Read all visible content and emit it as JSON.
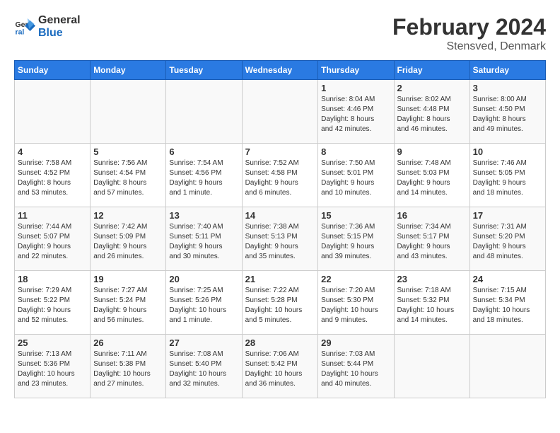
{
  "header": {
    "logo_line1": "General",
    "logo_line2": "Blue",
    "month_year": "February 2024",
    "location": "Stensved, Denmark"
  },
  "days_of_week": [
    "Sunday",
    "Monday",
    "Tuesday",
    "Wednesday",
    "Thursday",
    "Friday",
    "Saturday"
  ],
  "weeks": [
    [
      {
        "day": "",
        "info": ""
      },
      {
        "day": "",
        "info": ""
      },
      {
        "day": "",
        "info": ""
      },
      {
        "day": "",
        "info": ""
      },
      {
        "day": "1",
        "info": "Sunrise: 8:04 AM\nSunset: 4:46 PM\nDaylight: 8 hours\nand 42 minutes."
      },
      {
        "day": "2",
        "info": "Sunrise: 8:02 AM\nSunset: 4:48 PM\nDaylight: 8 hours\nand 46 minutes."
      },
      {
        "day": "3",
        "info": "Sunrise: 8:00 AM\nSunset: 4:50 PM\nDaylight: 8 hours\nand 49 minutes."
      }
    ],
    [
      {
        "day": "4",
        "info": "Sunrise: 7:58 AM\nSunset: 4:52 PM\nDaylight: 8 hours\nand 53 minutes."
      },
      {
        "day": "5",
        "info": "Sunrise: 7:56 AM\nSunset: 4:54 PM\nDaylight: 8 hours\nand 57 minutes."
      },
      {
        "day": "6",
        "info": "Sunrise: 7:54 AM\nSunset: 4:56 PM\nDaylight: 9 hours\nand 1 minute."
      },
      {
        "day": "7",
        "info": "Sunrise: 7:52 AM\nSunset: 4:58 PM\nDaylight: 9 hours\nand 6 minutes."
      },
      {
        "day": "8",
        "info": "Sunrise: 7:50 AM\nSunset: 5:01 PM\nDaylight: 9 hours\nand 10 minutes."
      },
      {
        "day": "9",
        "info": "Sunrise: 7:48 AM\nSunset: 5:03 PM\nDaylight: 9 hours\nand 14 minutes."
      },
      {
        "day": "10",
        "info": "Sunrise: 7:46 AM\nSunset: 5:05 PM\nDaylight: 9 hours\nand 18 minutes."
      }
    ],
    [
      {
        "day": "11",
        "info": "Sunrise: 7:44 AM\nSunset: 5:07 PM\nDaylight: 9 hours\nand 22 minutes."
      },
      {
        "day": "12",
        "info": "Sunrise: 7:42 AM\nSunset: 5:09 PM\nDaylight: 9 hours\nand 26 minutes."
      },
      {
        "day": "13",
        "info": "Sunrise: 7:40 AM\nSunset: 5:11 PM\nDaylight: 9 hours\nand 30 minutes."
      },
      {
        "day": "14",
        "info": "Sunrise: 7:38 AM\nSunset: 5:13 PM\nDaylight: 9 hours\nand 35 minutes."
      },
      {
        "day": "15",
        "info": "Sunrise: 7:36 AM\nSunset: 5:15 PM\nDaylight: 9 hours\nand 39 minutes."
      },
      {
        "day": "16",
        "info": "Sunrise: 7:34 AM\nSunset: 5:17 PM\nDaylight: 9 hours\nand 43 minutes."
      },
      {
        "day": "17",
        "info": "Sunrise: 7:31 AM\nSunset: 5:20 PM\nDaylight: 9 hours\nand 48 minutes."
      }
    ],
    [
      {
        "day": "18",
        "info": "Sunrise: 7:29 AM\nSunset: 5:22 PM\nDaylight: 9 hours\nand 52 minutes."
      },
      {
        "day": "19",
        "info": "Sunrise: 7:27 AM\nSunset: 5:24 PM\nDaylight: 9 hours\nand 56 minutes."
      },
      {
        "day": "20",
        "info": "Sunrise: 7:25 AM\nSunset: 5:26 PM\nDaylight: 10 hours\nand 1 minute."
      },
      {
        "day": "21",
        "info": "Sunrise: 7:22 AM\nSunset: 5:28 PM\nDaylight: 10 hours\nand 5 minutes."
      },
      {
        "day": "22",
        "info": "Sunrise: 7:20 AM\nSunset: 5:30 PM\nDaylight: 10 hours\nand 9 minutes."
      },
      {
        "day": "23",
        "info": "Sunrise: 7:18 AM\nSunset: 5:32 PM\nDaylight: 10 hours\nand 14 minutes."
      },
      {
        "day": "24",
        "info": "Sunrise: 7:15 AM\nSunset: 5:34 PM\nDaylight: 10 hours\nand 18 minutes."
      }
    ],
    [
      {
        "day": "25",
        "info": "Sunrise: 7:13 AM\nSunset: 5:36 PM\nDaylight: 10 hours\nand 23 minutes."
      },
      {
        "day": "26",
        "info": "Sunrise: 7:11 AM\nSunset: 5:38 PM\nDaylight: 10 hours\nand 27 minutes."
      },
      {
        "day": "27",
        "info": "Sunrise: 7:08 AM\nSunset: 5:40 PM\nDaylight: 10 hours\nand 32 minutes."
      },
      {
        "day": "28",
        "info": "Sunrise: 7:06 AM\nSunset: 5:42 PM\nDaylight: 10 hours\nand 36 minutes."
      },
      {
        "day": "29",
        "info": "Sunrise: 7:03 AM\nSunset: 5:44 PM\nDaylight: 10 hours\nand 40 minutes."
      },
      {
        "day": "",
        "info": ""
      },
      {
        "day": "",
        "info": ""
      }
    ]
  ]
}
